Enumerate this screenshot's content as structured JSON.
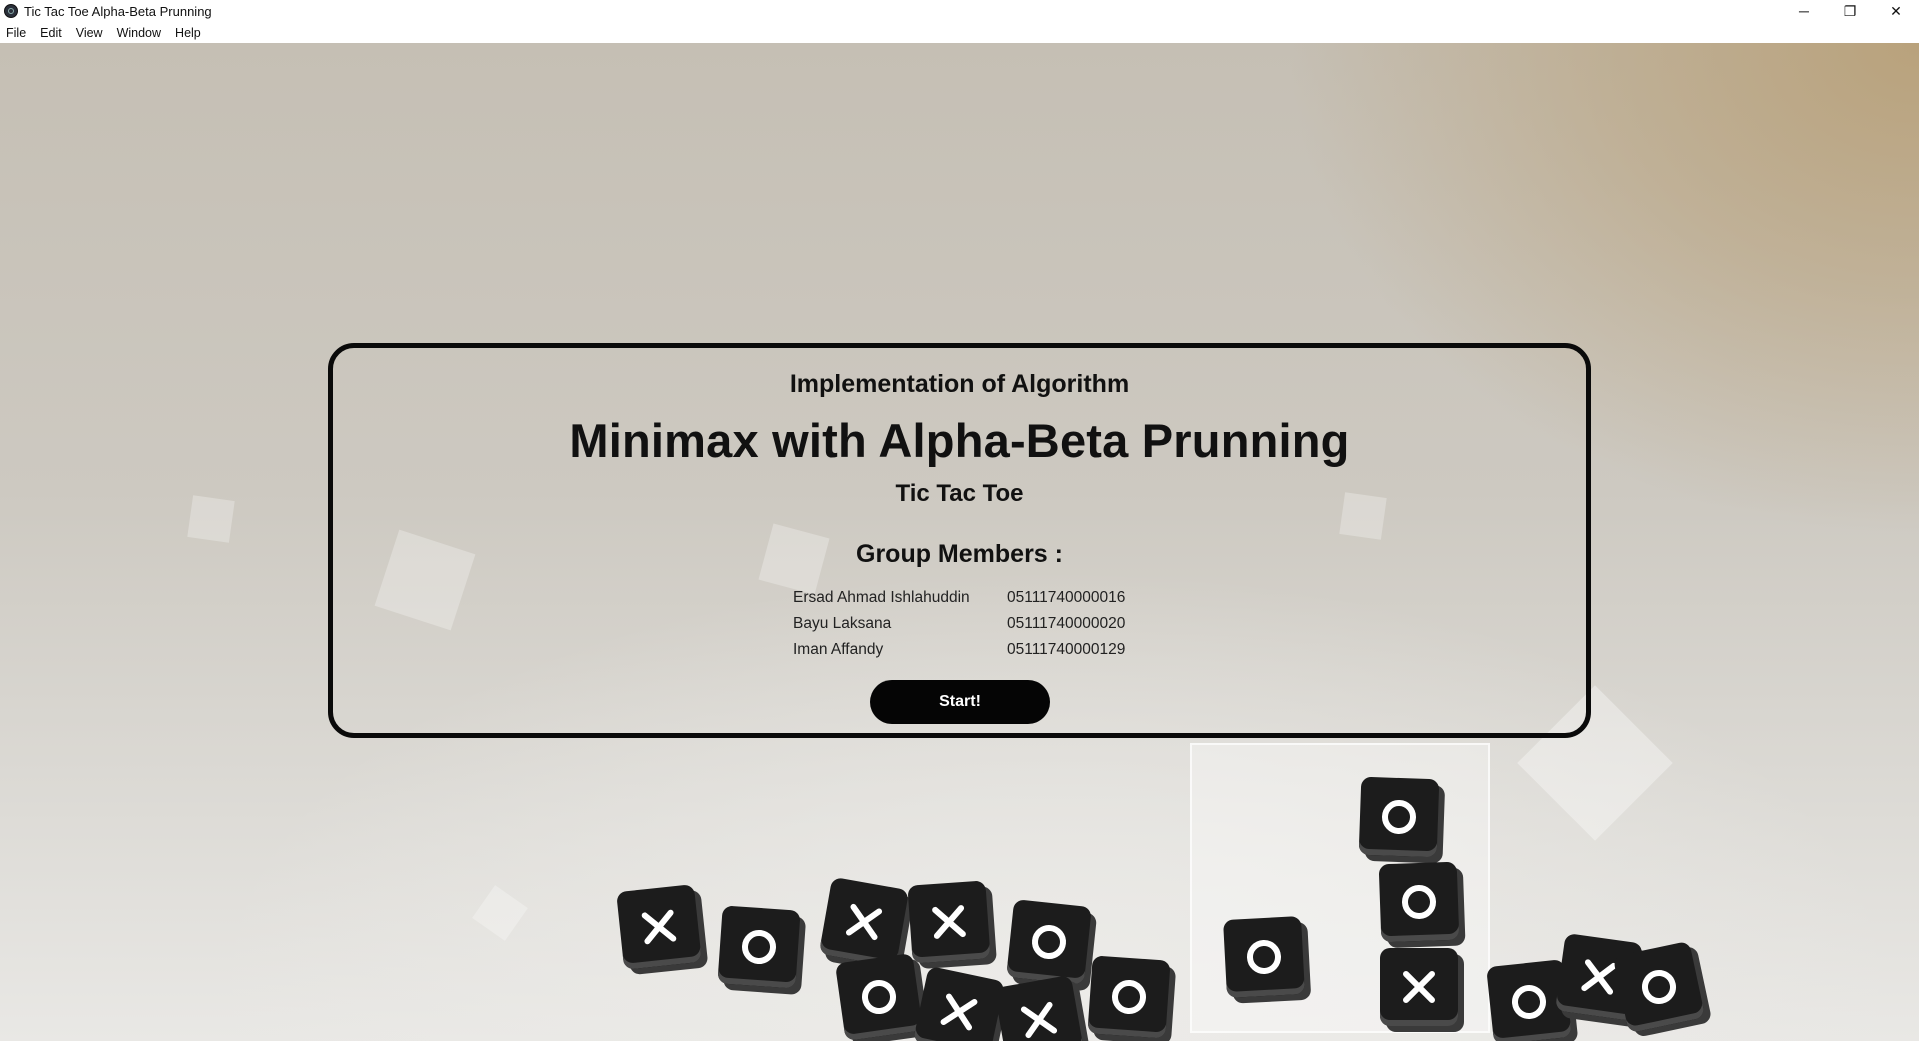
{
  "window": {
    "title": "Tic Tac Toe Alpha-Beta Prunning",
    "icon": "app-icon",
    "controls": {
      "minimize": "─",
      "maximize": "❐",
      "close": "✕"
    }
  },
  "menu": {
    "items": [
      "File",
      "Edit",
      "View",
      "Window",
      "Help"
    ]
  },
  "panel": {
    "subtitle": "Implementation of Algorithm",
    "title": "Minimax with Alpha-Beta Prunning",
    "game_name": "Tic Tac Toe",
    "members_heading": "Group Members :",
    "members": [
      {
        "name": "Ersad Ahmad Ishlahuddin",
        "id": "05111740000016"
      },
      {
        "name": "Bayu Laksana",
        "id": "05111740000020"
      },
      {
        "name": "Iman Affandy",
        "id": "05111740000129"
      }
    ],
    "start_label": "Start!"
  },
  "colors": {
    "panel_border": "#0a0a0a",
    "button_bg": "#050505",
    "button_text": "#ffffff"
  }
}
